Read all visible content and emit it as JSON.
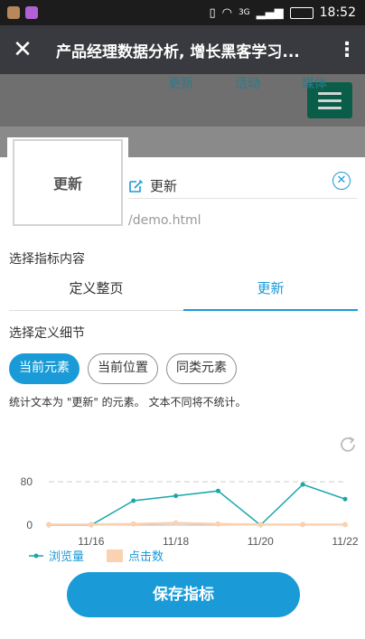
{
  "statusbar": {
    "time": "18:52",
    "network": "3G",
    "battery_level": 0.9
  },
  "titlebar": {
    "close_icon": "close-icon",
    "title": "产品经理数据分析, 增长黑客学习...",
    "more_icon": "more-vertical-icon"
  },
  "web_background": {
    "menu_icon": "hamburger-icon",
    "tabs": [
      "更新",
      "活动",
      "媒体"
    ]
  },
  "element": {
    "thumbnail_text": "更新",
    "name_value": "更新",
    "url": "/demo.html"
  },
  "metric_section": {
    "title": "选择指标内容",
    "tabs": [
      {
        "label": "定义整页",
        "active": false
      },
      {
        "label": "更新",
        "active": true
      }
    ]
  },
  "detail_section": {
    "title": "选择定义细节",
    "chips": [
      {
        "label": "当前元素",
        "active": true
      },
      {
        "label": "当前位置",
        "active": false
      },
      {
        "label": "同类元素",
        "active": false
      }
    ],
    "description": "统计文本为 \"更新\" 的元素。 文本不同将不统计。"
  },
  "colors": {
    "accent": "#1a9bd7",
    "views_line": "#1aa6ab",
    "clicks_line": "#f9d2b2"
  },
  "chart_data": {
    "type": "line",
    "x": [
      "11/15",
      "11/16",
      "11/17",
      "11/18",
      "11/19",
      "11/20",
      "11/21",
      "11/22"
    ],
    "x_tick_labels": [
      "11/16",
      "11/18",
      "11/20",
      "11/22"
    ],
    "y_ticks": [
      0,
      80
    ],
    "ylim": [
      0,
      100
    ],
    "series": [
      {
        "name": "浏览量",
        "values": [
          0,
          0,
          45,
          54,
          63,
          0,
          75,
          48
        ]
      },
      {
        "name": "点击数",
        "values": [
          1,
          1,
          2,
          4,
          2,
          1,
          1,
          1
        ]
      }
    ],
    "legend_position": "bottom-left"
  },
  "save_button": {
    "label": "保存指标"
  }
}
